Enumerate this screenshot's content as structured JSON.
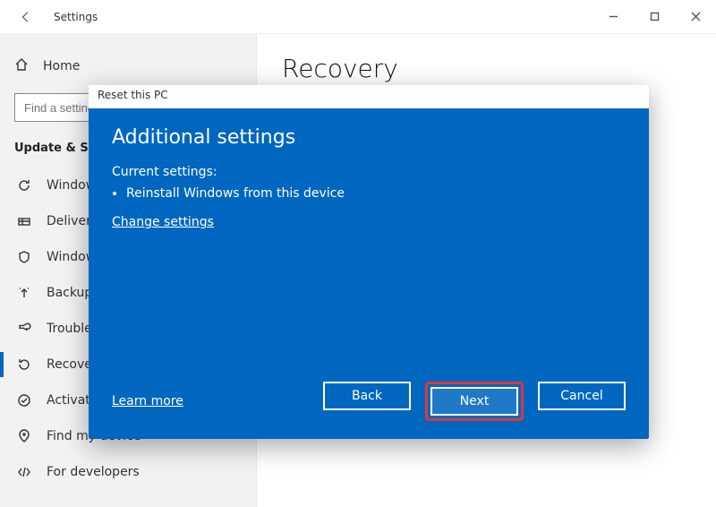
{
  "app": {
    "title": "Settings"
  },
  "window_controls": {
    "minimize": "–",
    "maximize": "□",
    "close": "×"
  },
  "sidebar": {
    "home": "Home",
    "search_placeholder": "Find a setting",
    "section": "Update & Security",
    "items": [
      "Windows Update",
      "Delivery Optimization",
      "Windows Security",
      "Backup",
      "Troubleshoot",
      "Recovery",
      "Activation",
      "Find my device",
      "For developers"
    ],
    "icons": [
      "refresh-icon",
      "delivery-icon",
      "shield-icon",
      "backup-icon",
      "wrench-icon",
      "recovery-icon",
      "check-circle-icon",
      "location-icon",
      "code-icon"
    ],
    "selected_index": 5
  },
  "content": {
    "page_title": "Recovery"
  },
  "dialog": {
    "title": "Reset this PC",
    "heading": "Additional settings",
    "current_label": "Current settings:",
    "bullets": [
      "Reinstall Windows from this device"
    ],
    "change": "Change settings",
    "learn_more": "Learn more",
    "buttons": {
      "back": "Back",
      "next": "Next",
      "cancel": "Cancel"
    }
  }
}
